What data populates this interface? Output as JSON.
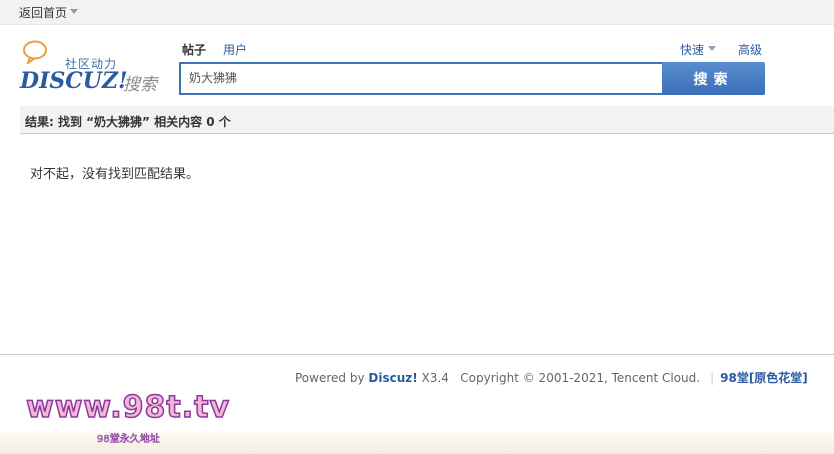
{
  "topbar": {
    "home_label": "返回首页"
  },
  "logo": {
    "tagline": "社区动力",
    "brand": "DISCUZ!",
    "brand_sub": "搜索"
  },
  "search": {
    "tabs": [
      {
        "label": "帖子",
        "active": true
      },
      {
        "label": "用户",
        "active": false
      }
    ],
    "quick_label": "快速",
    "advanced_label": "高级",
    "query": "奶大狒狒",
    "button_label": "搜索"
  },
  "results": {
    "summary": "结果: 找到 “奶大狒狒” 相关内容 0 个",
    "empty_message": "对不起，没有找到匹配结果。"
  },
  "footer": {
    "powered_prefix": "Powered by ",
    "powered_brand": "Discuz!",
    "version": " X3.4",
    "copyright": "Copyright © 2001-2021, Tencent Cloud.",
    "site_link": "98堂[原色花堂]"
  },
  "watermark": {
    "main": "www.98t.tv",
    "sub": "98堂永久地址"
  },
  "colors": {
    "accent": "#2b5b9f",
    "button": "#3a6eb8"
  }
}
